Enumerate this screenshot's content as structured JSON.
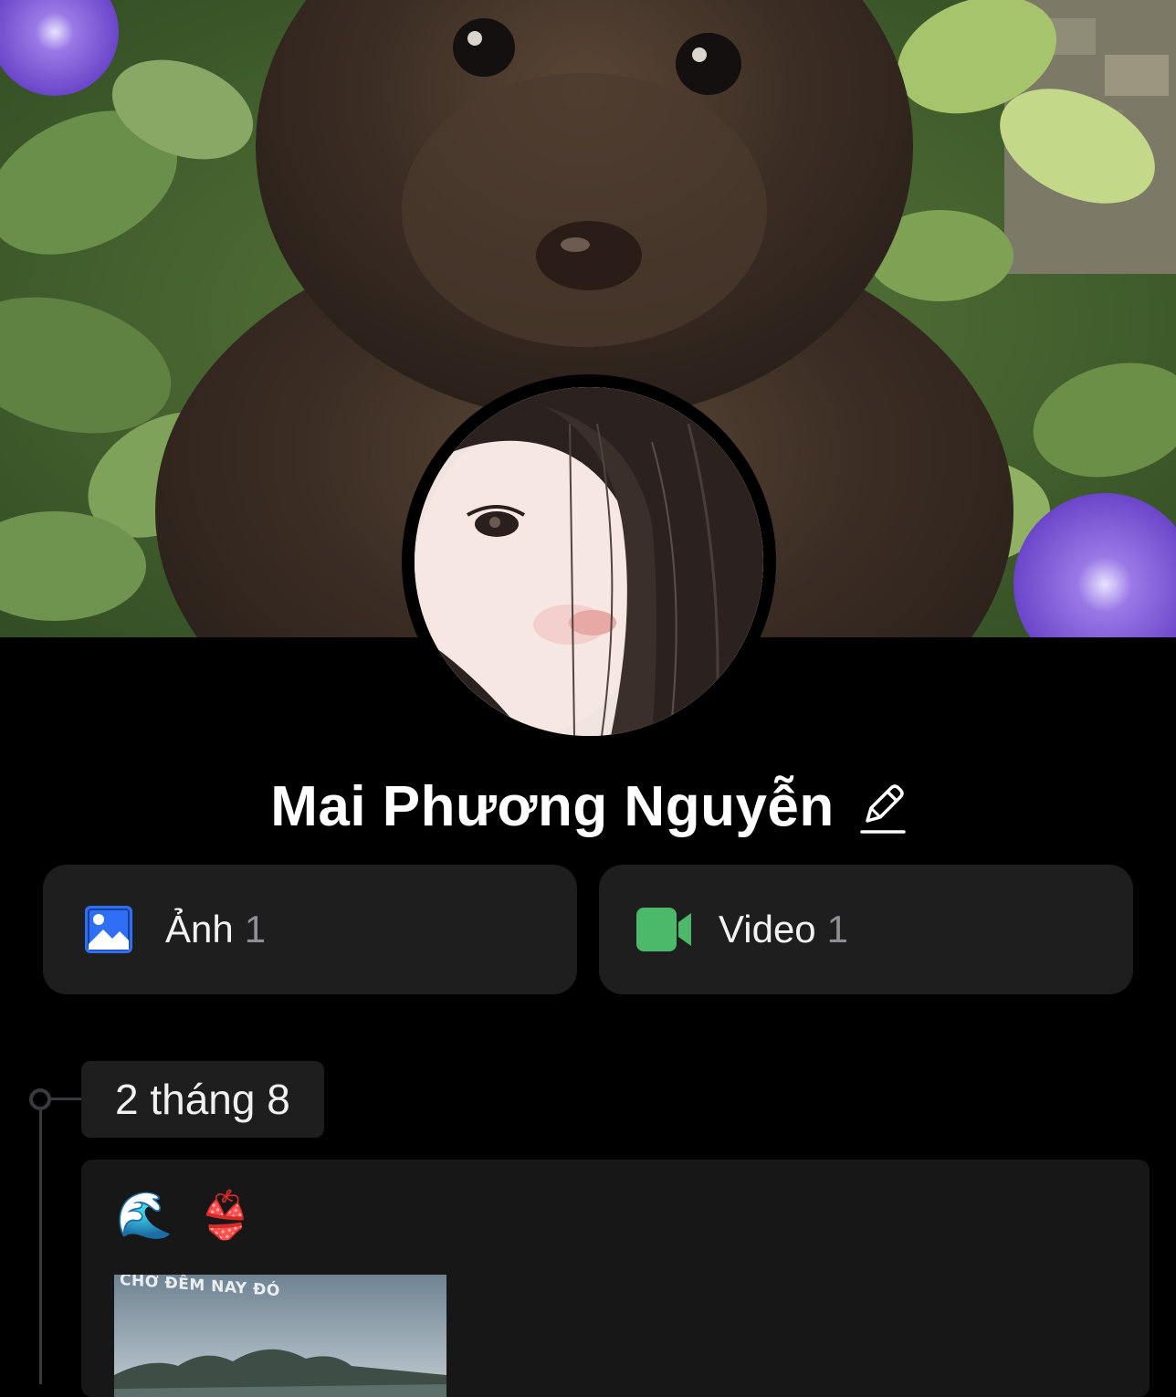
{
  "profile": {
    "name": "Mai Phương Nguyễn",
    "cover_icon": "cover-photo",
    "avatar_icon": "avatar-photo",
    "edit_icon": "pencil-icon"
  },
  "media": {
    "photos": {
      "label": "Ảnh",
      "count": "1",
      "icon": "photo-icon",
      "color": "#2f6ff5"
    },
    "videos": {
      "label": "Video",
      "count": "1",
      "icon": "video-camera-icon",
      "color": "#4cb86a"
    }
  },
  "timeline": {
    "date": "2 tháng 8",
    "post": {
      "emoji": "🌊 👙",
      "thumbnail_caption": "CHỜ ĐÊM NAY ĐÓ"
    }
  }
}
